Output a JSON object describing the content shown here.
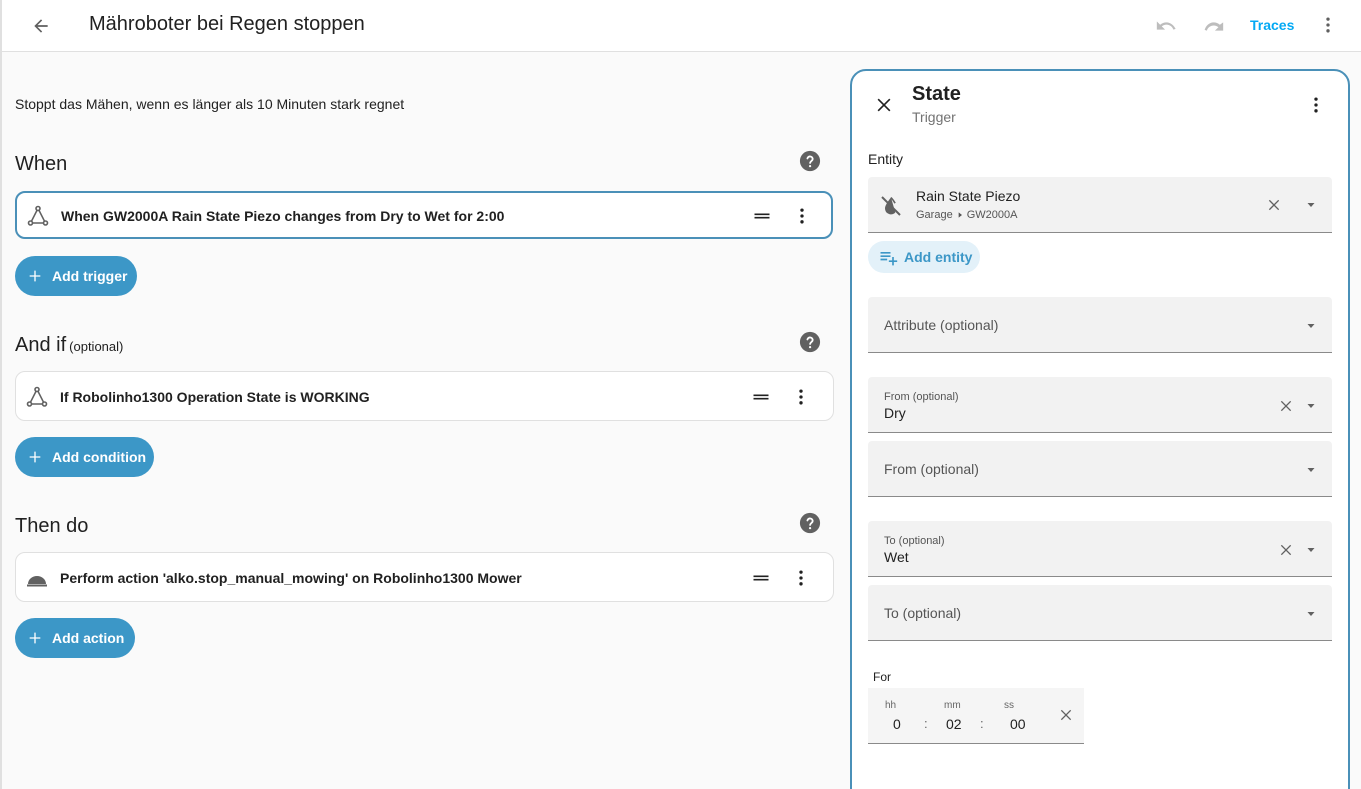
{
  "header": {
    "title": "Mähroboter bei Regen stoppen",
    "traces_label": "Traces"
  },
  "description": "Stoppt das Mähen, wenn es länger als 10 Minuten stark regnet",
  "sections": {
    "when": {
      "title": "When",
      "item": "When GW2000A Rain State Piezo changes from Dry to Wet for 2:00",
      "add_label": "Add trigger"
    },
    "andif": {
      "title": "And if",
      "optional": "(optional)",
      "item": "If Robolinho1300 Operation State is WORKING",
      "add_label": "Add condition"
    },
    "then": {
      "title": "Then do",
      "item": "Perform action 'alko.stop_manual_mowing' on Robolinho1300 Mower",
      "add_label": "Add action"
    }
  },
  "panel": {
    "title": "State",
    "subtitle": "Trigger",
    "entity_label": "Entity",
    "entity": {
      "name": "Rain State Piezo",
      "area": "Garage",
      "device": "GW2000A"
    },
    "add_entity_label": "Add entity",
    "attribute_placeholder": "Attribute (optional)",
    "from_label": "From (optional)",
    "from_value": "Dry",
    "from_placeholder": "From (optional)",
    "to_label": "To (optional)",
    "to_value": "Wet",
    "to_placeholder": "To (optional)",
    "for_label": "For",
    "duration": {
      "hh_label": "hh",
      "hh": "0",
      "mm_label": "mm",
      "mm": "02",
      "ss_label": "ss",
      "ss": "00",
      "sep": ":"
    }
  }
}
